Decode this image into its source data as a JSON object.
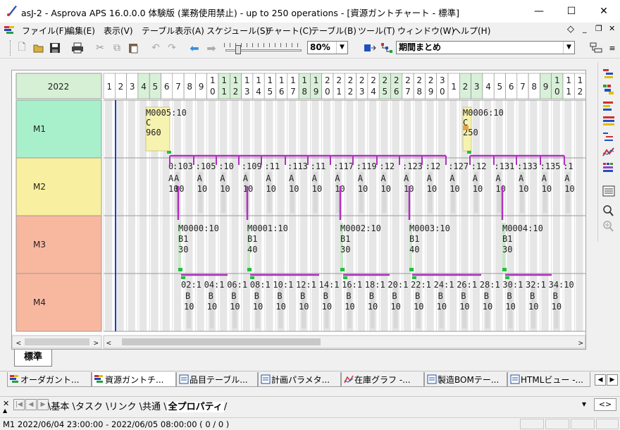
{
  "window": {
    "title": "asJ-2 - Asprova APS 16.0.0.0 体験版 (業務使用禁止)  - up to 250 operations  - [資源ガントチャート - 標準]",
    "minimize": "—",
    "maximize": "☐",
    "close": "✕"
  },
  "menu": {
    "items": [
      "ファイル(F)",
      "編集(E)",
      "表示(V)",
      "テーブル表示(A)",
      "スケジュール(S)",
      "チャート(C)",
      "テーブル(B)",
      "ツール(T)",
      "ウィンドウ(W)",
      "ヘルプ(H)"
    ]
  },
  "toolbar": {
    "zoom_value": "80%",
    "period_value": "期間まとめ"
  },
  "gantt": {
    "year_header": "2022",
    "day_labels": [
      "1",
      "2",
      "3",
      "4",
      "5",
      "6",
      "7",
      "8",
      "9",
      "10",
      "11",
      "12",
      "13",
      "14",
      "15",
      "16",
      "17",
      "18",
      "19",
      "20",
      "21",
      "22",
      "23",
      "24",
      "25",
      "26",
      "27",
      "28",
      "29",
      "30",
      "1",
      "2",
      "3",
      "4",
      "5",
      "6",
      "7",
      "8",
      "9",
      "10",
      "11",
      "12"
    ],
    "resources": [
      "M1",
      "M2",
      "M3",
      "M4"
    ],
    "m1_ops": [
      {
        "code": "M0005:10",
        "item": "C",
        "qty": "960"
      },
      {
        "code": "M0006:10",
        "item": "C",
        "qty": "250"
      }
    ],
    "m2_ops": [
      "0",
      "1:10",
      "3:10",
      "5:10",
      "7:10",
      "9:10",
      "11:10",
      "13:10",
      "15:10",
      "17:10",
      "19:10",
      "21:10",
      "23:10",
      "25:10",
      "27:10",
      "29:10",
      "31:10",
      "33:10",
      "35:10"
    ],
    "m2_op_labels": [
      ":103",
      ":105",
      ":10",
      ":109",
      ":11",
      ":113",
      ":11",
      ":117",
      ":119",
      ":12",
      ":123",
      ":12",
      ":127",
      ":12",
      ":131",
      ":133",
      ":135",
      ":1"
    ],
    "m2_item": "A",
    "m2_qty": "10",
    "m3_ops": [
      {
        "code": "M0000:10",
        "item": "B1",
        "qty": "30"
      },
      {
        "code": "M0001:10",
        "item": "B1",
        "qty": "40"
      },
      {
        "code": "M0002:10",
        "item": "B1",
        "qty": "30"
      },
      {
        "code": "M0003:10",
        "item": "B1",
        "qty": "40"
      },
      {
        "code": "M0004:10",
        "item": "B1",
        "qty": "30"
      }
    ],
    "m4_op_labels": [
      "02:1",
      "04:1",
      "06:1",
      "08:1",
      "10:1",
      "12:1",
      "14:1",
      "16:1",
      "18:1",
      "20:1",
      "22:1",
      "24:1",
      "26:1",
      "28:1",
      "30:1",
      "32:1",
      "34:10"
    ],
    "m4_item": "B",
    "m4_qty": "10",
    "sheet_tab": "標準"
  },
  "doc_tabs": [
    "オーダガント...",
    "資源ガントチ...",
    "品目テーブル...",
    "計画パラメタ...",
    "在庫グラフ -...",
    "製造BOMテー...",
    "HTMLビュー -..."
  ],
  "prop_tabs": [
    "基本",
    "タスク",
    "リンク",
    "共通",
    "全プロパティ"
  ],
  "status": {
    "text": "M1 2022/06/04 23:00:00 - 2022/06/05 08:00:00 ( 0 / 0 )"
  }
}
